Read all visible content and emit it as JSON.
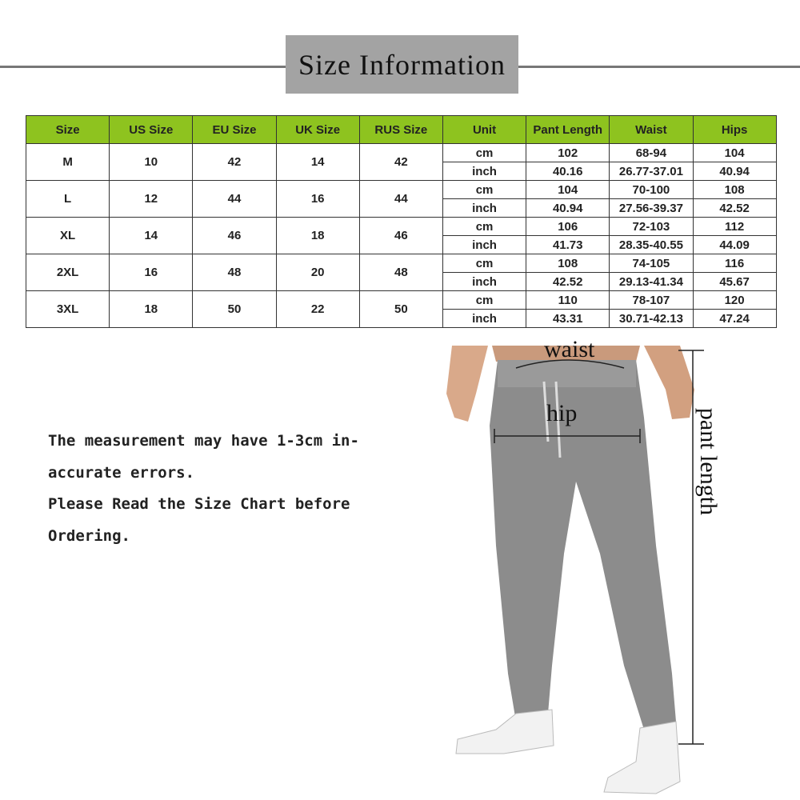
{
  "title": "Size Information",
  "table": {
    "headers": [
      "Size",
      "US Size",
      "EU Size",
      "UK Size",
      "RUS Size",
      "Unit",
      "Pant Length",
      "Waist",
      "Hips"
    ],
    "rows": [
      {
        "size": "M",
        "us": "10",
        "eu": "42",
        "uk": "14",
        "rus": "42",
        "cm": {
          "unit": "cm",
          "length": "102",
          "waist": "68-94",
          "hips": "104"
        },
        "inch": {
          "unit": "inch",
          "length": "40.16",
          "waist": "26.77-37.01",
          "hips": "40.94"
        }
      },
      {
        "size": "L",
        "us": "12",
        "eu": "44",
        "uk": "16",
        "rus": "44",
        "cm": {
          "unit": "cm",
          "length": "104",
          "waist": "70-100",
          "hips": "108"
        },
        "inch": {
          "unit": "inch",
          "length": "40.94",
          "waist": "27.56-39.37",
          "hips": "42.52"
        }
      },
      {
        "size": "XL",
        "us": "14",
        "eu": "46",
        "uk": "18",
        "rus": "46",
        "cm": {
          "unit": "cm",
          "length": "106",
          "waist": "72-103",
          "hips": "112"
        },
        "inch": {
          "unit": "inch",
          "length": "41.73",
          "waist": "28.35-40.55",
          "hips": "44.09"
        }
      },
      {
        "size": "2XL",
        "us": "16",
        "eu": "48",
        "uk": "20",
        "rus": "48",
        "cm": {
          "unit": "cm",
          "length": "108",
          "waist": "74-105",
          "hips": "116"
        },
        "inch": {
          "unit": "inch",
          "length": "42.52",
          "waist": "29.13-41.34",
          "hips": "45.67"
        }
      },
      {
        "size": "3XL",
        "us": "18",
        "eu": "50",
        "uk": "22",
        "rus": "50",
        "cm": {
          "unit": "cm",
          "length": "110",
          "waist": "78-107",
          "hips": "120"
        },
        "inch": {
          "unit": "inch",
          "length": "43.31",
          "waist": "30.71-42.13",
          "hips": "47.24"
        }
      }
    ]
  },
  "note": [
    "The measurement may have 1-3cm in-",
    "accurate errors.",
    "Please Read the Size Chart before",
    "Ordering."
  ],
  "labels": {
    "waist": "waist",
    "hip": "hip",
    "length": "pant length"
  },
  "colors": {
    "header": "#8ec31f",
    "title_box": "#a3a3a3",
    "pants": "#8c8c8c"
  }
}
